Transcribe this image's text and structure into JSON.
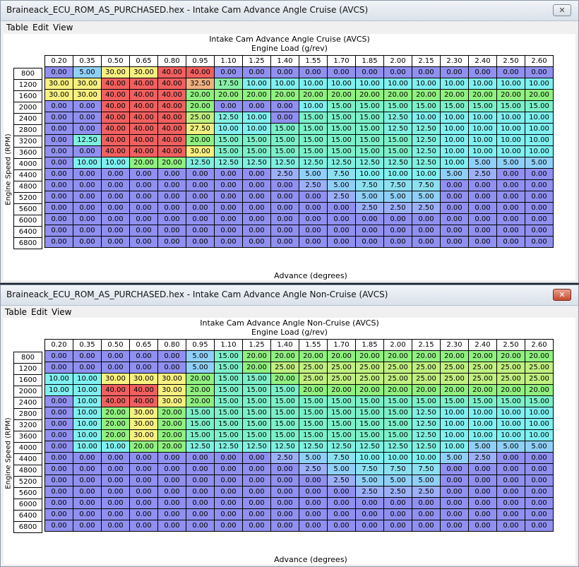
{
  "colors": {
    "0.00": "#9090f0",
    "2.50": "#9cb0f8",
    "5.00": "#90d0f8",
    "7.50": "#8ce0f0",
    "10.00": "#80f0f0",
    "12.50": "#80f0e0",
    "15.00": "#7cf0c8",
    "17.50": "#88f0a8",
    "20.00": "#90f080",
    "25.00": "#c0f080",
    "27.50": "#f0f080",
    "30.00": "#f8f080",
    "32.50": "#f0b080",
    "40.00": "#f06060"
  },
  "windows": [
    {
      "title": "Braineack_ECU_ROM_AS_PURCHASED.hex - Intake Cam Advance Angle Cruise (AVCS)",
      "close_glyph": "✕",
      "menu": [
        "Table",
        "Edit",
        "View"
      ],
      "table_title": "Intake Cam Advance Angle Cruise (AVCS)",
      "x_axis_label": "Engine Load (g/rev)",
      "y_axis_label": "Engine Speed (RPM)",
      "z_label": "Advance (degrees)",
      "columns": [
        "0.20",
        "0.35",
        "0.50",
        "0.65",
        "0.80",
        "0.95",
        "1.10",
        "1.25",
        "1.40",
        "1.55",
        "1.70",
        "1.85",
        "2.00",
        "2.15",
        "2.30",
        "2.40",
        "2.50",
        "2.60"
      ],
      "rows": [
        "800",
        "1200",
        "1600",
        "2000",
        "2400",
        "2800",
        "3200",
        "3600",
        "4000",
        "4400",
        "4800",
        "5200",
        "5600",
        "6000",
        "6400",
        "6800"
      ],
      "cells": [
        [
          "0.00",
          "5.00",
          "30.00",
          "30.00",
          "40.00",
          "40.00",
          "0.00",
          "0.00",
          "0.00",
          "0.00",
          "0.00",
          "0.00",
          "0.00",
          "0.00",
          "0.00",
          "0.00",
          "0.00",
          "0.00"
        ],
        [
          "30.00",
          "30.00",
          "40.00",
          "40.00",
          "40.00",
          "32.50",
          "17.50",
          "10.00",
          "10.00",
          "10.00",
          "10.00",
          "10.00",
          "10.00",
          "10.00",
          "10.00",
          "10.00",
          "10.00",
          "10.00"
        ],
        [
          "30.00",
          "30.00",
          "40.00",
          "40.00",
          "40.00",
          "20.00",
          "20.00",
          "20.00",
          "20.00",
          "20.00",
          "20.00",
          "20.00",
          "20.00",
          "20.00",
          "20.00",
          "20.00",
          "20.00",
          "20.00"
        ],
        [
          "0.00",
          "0.00",
          "40.00",
          "40.00",
          "40.00",
          "20.00",
          "0.00",
          "0.00",
          "0.00",
          "10.00",
          "15.00",
          "15.00",
          "15.00",
          "15.00",
          "15.00",
          "15.00",
          "15.00",
          "15.00"
        ],
        [
          "0.00",
          "0.00",
          "40.00",
          "40.00",
          "40.00",
          "25.00",
          "12.50",
          "10.00",
          "0.00",
          "15.00",
          "15.00",
          "15.00",
          "12.50",
          "10.00",
          "10.00",
          "10.00",
          "10.00",
          "10.00"
        ],
        [
          "0.00",
          "0.00",
          "40.00",
          "40.00",
          "40.00",
          "27.50",
          "10.00",
          "10.00",
          "15.00",
          "15.00",
          "15.00",
          "15.00",
          "12.50",
          "12.50",
          "10.00",
          "10.00",
          "10.00",
          "10.00"
        ],
        [
          "0.00",
          "12.50",
          "40.00",
          "40.00",
          "40.00",
          "20.00",
          "15.00",
          "15.00",
          "15.00",
          "15.00",
          "15.00",
          "15.00",
          "15.00",
          "12.50",
          "10.00",
          "10.00",
          "10.00",
          "10.00"
        ],
        [
          "0.00",
          "0.00",
          "40.00",
          "40.00",
          "40.00",
          "30.00",
          "15.00",
          "15.00",
          "15.00",
          "15.00",
          "15.00",
          "15.00",
          "15.00",
          "12.50",
          "10.00",
          "10.00",
          "10.00",
          "10.00"
        ],
        [
          "0.00",
          "10.00",
          "10.00",
          "20.00",
          "20.00",
          "12.50",
          "12.50",
          "12.50",
          "12.50",
          "12.50",
          "12.50",
          "12.50",
          "12.50",
          "12.50",
          "10.00",
          "5.00",
          "5.00",
          "5.00"
        ],
        [
          "0.00",
          "0.00",
          "0.00",
          "0.00",
          "0.00",
          "0.00",
          "0.00",
          "0.00",
          "2.50",
          "5.00",
          "7.50",
          "10.00",
          "10.00",
          "10.00",
          "5.00",
          "2.50",
          "0.00",
          "0.00"
        ],
        [
          "0.00",
          "0.00",
          "0.00",
          "0.00",
          "0.00",
          "0.00",
          "0.00",
          "0.00",
          "0.00",
          "2.50",
          "5.00",
          "7.50",
          "7.50",
          "7.50",
          "0.00",
          "0.00",
          "0.00",
          "0.00"
        ],
        [
          "0.00",
          "0.00",
          "0.00",
          "0.00",
          "0.00",
          "0.00",
          "0.00",
          "0.00",
          "0.00",
          "0.00",
          "2.50",
          "5.00",
          "5.00",
          "5.00",
          "0.00",
          "0.00",
          "0.00",
          "0.00"
        ],
        [
          "0.00",
          "0.00",
          "0.00",
          "0.00",
          "0.00",
          "0.00",
          "0.00",
          "0.00",
          "0.00",
          "0.00",
          "0.00",
          "2.50",
          "2.50",
          "2.50",
          "0.00",
          "0.00",
          "0.00",
          "0.00"
        ],
        [
          "0.00",
          "0.00",
          "0.00",
          "0.00",
          "0.00",
          "0.00",
          "0.00",
          "0.00",
          "0.00",
          "0.00",
          "0.00",
          "0.00",
          "0.00",
          "0.00",
          "0.00",
          "0.00",
          "0.00",
          "0.00"
        ],
        [
          "0.00",
          "0.00",
          "0.00",
          "0.00",
          "0.00",
          "0.00",
          "0.00",
          "0.00",
          "0.00",
          "0.00",
          "0.00",
          "0.00",
          "0.00",
          "0.00",
          "0.00",
          "0.00",
          "0.00",
          "0.00"
        ],
        [
          "0.00",
          "0.00",
          "0.00",
          "0.00",
          "0.00",
          "0.00",
          "0.00",
          "0.00",
          "0.00",
          "0.00",
          "0.00",
          "0.00",
          "0.00",
          "0.00",
          "0.00",
          "0.00",
          "0.00",
          "0.00"
        ]
      ]
    },
    {
      "title": "Braineack_ECU_ROM_AS_PURCHASED.hex - Intake Cam Advance Angle Non-Cruise (AVCS)",
      "close_glyph": "✕",
      "menu": [
        "Table",
        "Edit",
        "View"
      ],
      "table_title": "Intake Cam Advance Angle Non-Cruise (AVCS)",
      "x_axis_label": "Engine Load (g/rev)",
      "y_axis_label": "Engine Speed (RPM)",
      "z_label": "Advance (degrees)",
      "columns": [
        "0.20",
        "0.35",
        "0.50",
        "0.65",
        "0.80",
        "0.95",
        "1.10",
        "1.25",
        "1.40",
        "1.55",
        "1.70",
        "1.85",
        "2.00",
        "2.15",
        "2.30",
        "2.40",
        "2.50",
        "2.60"
      ],
      "rows": [
        "800",
        "1200",
        "1600",
        "2000",
        "2400",
        "2800",
        "3200",
        "3600",
        "4000",
        "4400",
        "4800",
        "5200",
        "5600",
        "6000",
        "6400",
        "6800"
      ],
      "cells": [
        [
          "0.00",
          "0.00",
          "0.00",
          "0.00",
          "0.00",
          "5.00",
          "15.00",
          "20.00",
          "20.00",
          "20.00",
          "20.00",
          "20.00",
          "20.00",
          "20.00",
          "20.00",
          "20.00",
          "20.00",
          "20.00"
        ],
        [
          "0.00",
          "0.00",
          "0.00",
          "0.00",
          "0.00",
          "5.00",
          "15.00",
          "20.00",
          "25.00",
          "25.00",
          "25.00",
          "25.00",
          "25.00",
          "25.00",
          "25.00",
          "25.00",
          "25.00",
          "25.00"
        ],
        [
          "10.00",
          "10.00",
          "30.00",
          "30.00",
          "30.00",
          "20.00",
          "15.00",
          "15.00",
          "20.00",
          "25.00",
          "25.00",
          "25.00",
          "25.00",
          "25.00",
          "25.00",
          "25.00",
          "25.00",
          "25.00"
        ],
        [
          "10.00",
          "10.00",
          "40.00",
          "40.00",
          "30.00",
          "20.00",
          "15.00",
          "15.00",
          "15.00",
          "20.00",
          "20.00",
          "20.00",
          "20.00",
          "20.00",
          "20.00",
          "20.00",
          "20.00",
          "20.00"
        ],
        [
          "0.00",
          "10.00",
          "40.00",
          "40.00",
          "30.00",
          "20.00",
          "15.00",
          "15.00",
          "15.00",
          "15.00",
          "15.00",
          "15.00",
          "15.00",
          "15.00",
          "15.00",
          "15.00",
          "15.00",
          "15.00"
        ],
        [
          "0.00",
          "10.00",
          "20.00",
          "30.00",
          "20.00",
          "15.00",
          "15.00",
          "15.00",
          "15.00",
          "15.00",
          "15.00",
          "15.00",
          "15.00",
          "12.50",
          "10.00",
          "10.00",
          "10.00",
          "10.00"
        ],
        [
          "0.00",
          "10.00",
          "20.00",
          "30.00",
          "20.00",
          "15.00",
          "15.00",
          "15.00",
          "15.00",
          "15.00",
          "15.00",
          "15.00",
          "15.00",
          "12.50",
          "10.00",
          "10.00",
          "10.00",
          "10.00"
        ],
        [
          "0.00",
          "10.00",
          "20.00",
          "30.00",
          "20.00",
          "15.00",
          "15.00",
          "15.00",
          "15.00",
          "15.00",
          "15.00",
          "15.00",
          "15.00",
          "12.50",
          "10.00",
          "10.00",
          "10.00",
          "10.00"
        ],
        [
          "0.00",
          "10.00",
          "10.00",
          "20.00",
          "20.00",
          "12.50",
          "12.50",
          "12.50",
          "12.50",
          "12.50",
          "12.50",
          "12.50",
          "12.50",
          "12.50",
          "10.00",
          "5.00",
          "5.00",
          "5.00"
        ],
        [
          "0.00",
          "0.00",
          "0.00",
          "0.00",
          "0.00",
          "0.00",
          "0.00",
          "0.00",
          "2.50",
          "5.00",
          "7.50",
          "10.00",
          "10.00",
          "10.00",
          "5.00",
          "2.50",
          "0.00",
          "0.00"
        ],
        [
          "0.00",
          "0.00",
          "0.00",
          "0.00",
          "0.00",
          "0.00",
          "0.00",
          "0.00",
          "0.00",
          "2.50",
          "5.00",
          "7.50",
          "7.50",
          "7.50",
          "0.00",
          "0.00",
          "0.00",
          "0.00"
        ],
        [
          "0.00",
          "0.00",
          "0.00",
          "0.00",
          "0.00",
          "0.00",
          "0.00",
          "0.00",
          "0.00",
          "0.00",
          "2.50",
          "5.00",
          "5.00",
          "5.00",
          "0.00",
          "0.00",
          "0.00",
          "0.00"
        ],
        [
          "0.00",
          "0.00",
          "0.00",
          "0.00",
          "0.00",
          "0.00",
          "0.00",
          "0.00",
          "0.00",
          "0.00",
          "0.00",
          "2.50",
          "2.50",
          "2.50",
          "0.00",
          "0.00",
          "0.00",
          "0.00"
        ],
        [
          "0.00",
          "0.00",
          "0.00",
          "0.00",
          "0.00",
          "0.00",
          "0.00",
          "0.00",
          "0.00",
          "0.00",
          "0.00",
          "0.00",
          "0.00",
          "0.00",
          "0.00",
          "0.00",
          "0.00",
          "0.00"
        ],
        [
          "0.00",
          "0.00",
          "0.00",
          "0.00",
          "0.00",
          "0.00",
          "0.00",
          "0.00",
          "0.00",
          "0.00",
          "0.00",
          "0.00",
          "0.00",
          "0.00",
          "0.00",
          "0.00",
          "0.00",
          "0.00"
        ],
        [
          "0.00",
          "0.00",
          "0.00",
          "0.00",
          "0.00",
          "0.00",
          "0.00",
          "0.00",
          "0.00",
          "0.00",
          "0.00",
          "0.00",
          "0.00",
          "0.00",
          "0.00",
          "0.00",
          "0.00",
          "0.00"
        ]
      ]
    }
  ]
}
